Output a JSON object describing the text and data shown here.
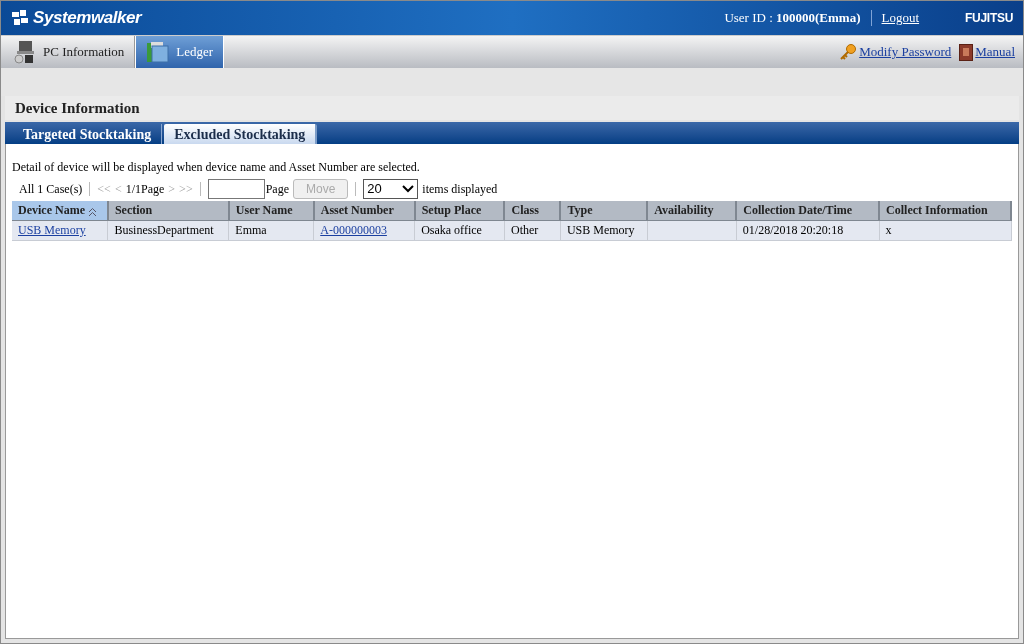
{
  "header": {
    "logo": "Systemwalker",
    "user_label": "User ID : ",
    "user_value": "100000(Emma)",
    "logout": "Logout",
    "brand": "FUJITSU"
  },
  "nav_tabs": [
    {
      "label": "PC Information",
      "selected": false,
      "kind": "pc"
    },
    {
      "label": "Ledger",
      "selected": true,
      "kind": "ledger"
    }
  ],
  "nav_links": [
    {
      "label": "Modify Password",
      "kind": "key"
    },
    {
      "label": "Manual",
      "kind": "book"
    }
  ],
  "page_title": "Device Information",
  "tabs": [
    {
      "label": "Targeted Stocktaking",
      "selected": false
    },
    {
      "label": "Excluded Stocktaking",
      "selected": true
    }
  ],
  "note": "Detail of device will be displayed when device name and Asset Number are selected.",
  "pager": {
    "total": "All 1 Case(s)",
    "first": "<<",
    "prev": "<",
    "page": "1/1Page",
    "next": ">",
    "last": ">>",
    "page_label": "Page",
    "move": "Move",
    "move_disabled": true,
    "per_page": "20",
    "per_page_label": "items displayed"
  },
  "table": {
    "columns": [
      {
        "label": "Device Name",
        "sorted": true
      },
      {
        "label": "Section",
        "sorted": false
      },
      {
        "label": "User Name",
        "sorted": false
      },
      {
        "label": "Asset Number",
        "sorted": false
      },
      {
        "label": "Setup Place",
        "sorted": false
      },
      {
        "label": "Class",
        "sorted": false
      },
      {
        "label": "Type",
        "sorted": false
      },
      {
        "label": "Availability",
        "sorted": false
      },
      {
        "label": "Collection Date/Time",
        "sorted": false
      },
      {
        "label": "Collect Information",
        "sorted": false
      }
    ],
    "rows": [
      {
        "cells": [
          {
            "text": "USB Memory",
            "kind": "link"
          },
          {
            "text": "BusinessDepartment",
            "kind": "text"
          },
          {
            "text": "Emma",
            "kind": "text"
          },
          {
            "text": "A-000000003",
            "kind": "link"
          },
          {
            "text": "Osaka office",
            "kind": "text"
          },
          {
            "text": "Other",
            "kind": "text"
          },
          {
            "text": "USB Memory",
            "kind": "text"
          },
          {
            "kind": "empty"
          },
          {
            "text": "01/28/2018 20:20:18",
            "kind": "text"
          },
          {
            "text": "x",
            "kind": "text"
          }
        ]
      }
    ]
  }
}
